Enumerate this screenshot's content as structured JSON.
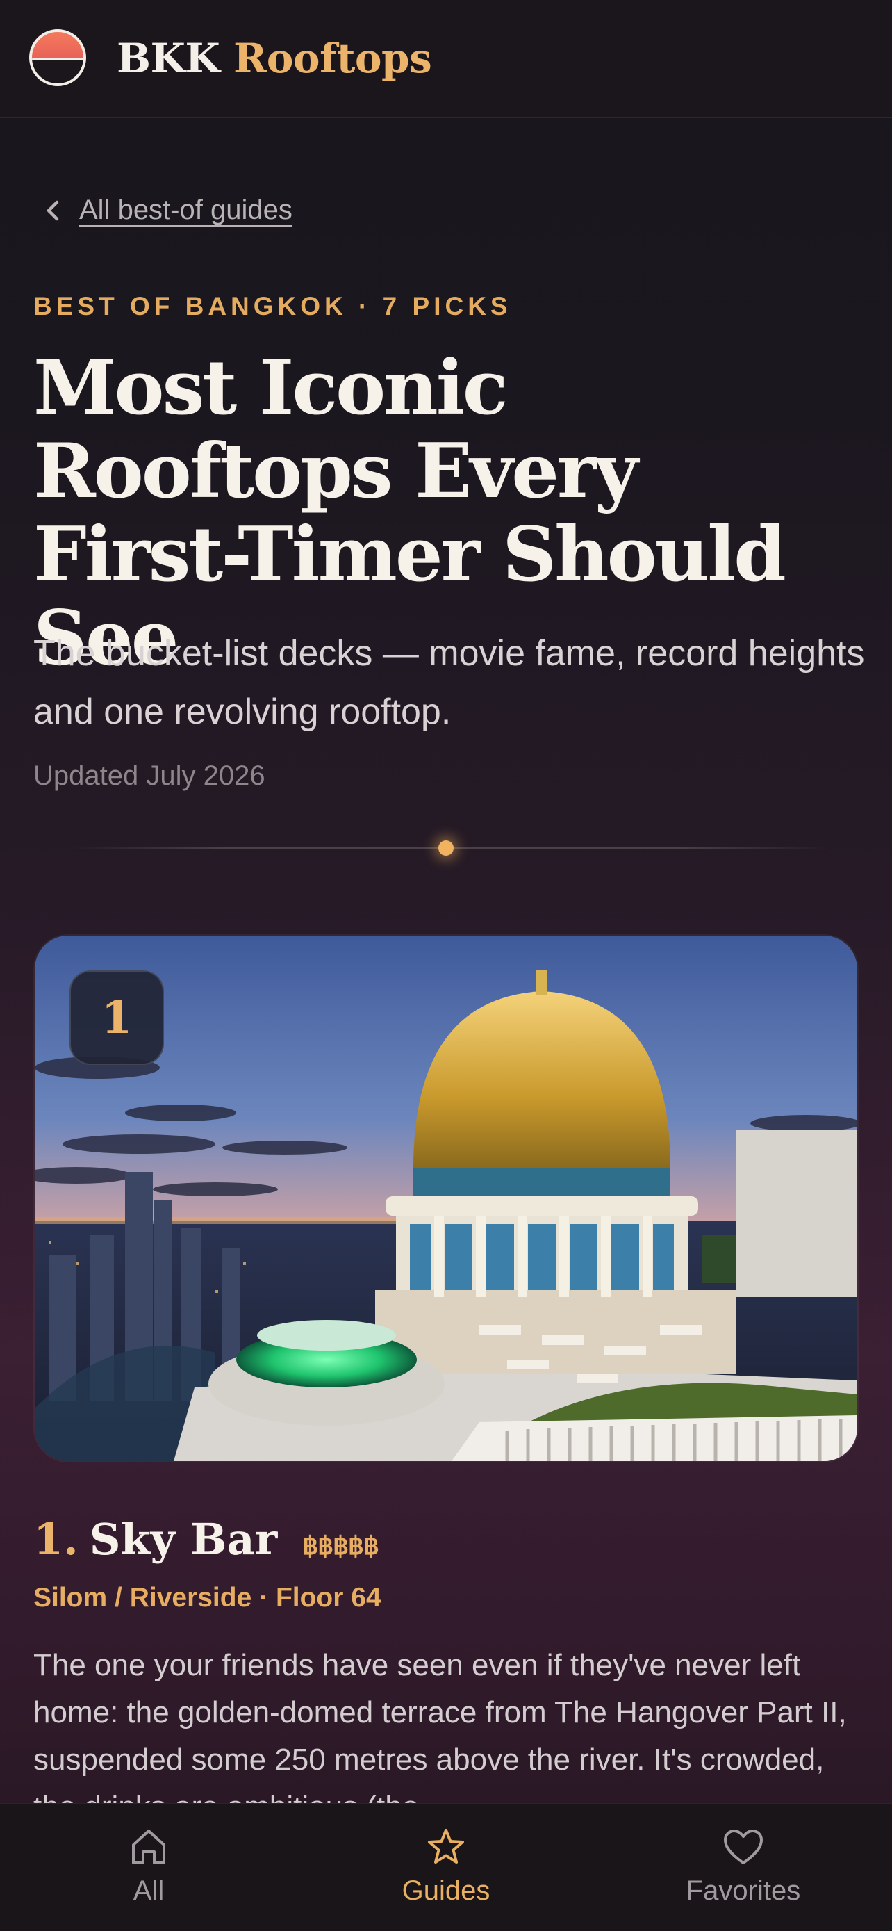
{
  "app": {
    "brand_part1": "BKK",
    "brand_part2": "Rooftops",
    "logo_icon": "sunset-logo-icon",
    "accent_color": "#ebb46a"
  },
  "header": {
    "back_label": "All best-of guides",
    "kicker": "BEST OF BANGKOK · 7 PICKS",
    "title": "Most Iconic Rooftops Every First-Timer Should See",
    "subtitle": "The bucket-list decks — movie fame, record heights and one revolving rooftop.",
    "updated": "Updated July 2026"
  },
  "pick": {
    "rank_badge": "1",
    "number": "1.",
    "name": "Sky Bar",
    "price": "฿฿฿฿฿",
    "meta": "Silom / Riverside · Floor 64",
    "description": "The one your friends have seen even if they've never left home: the golden-domed terrace from The Hangover Part II, suspended some 250 metres above the river. It's crowded, the drinks are ambitious (the"
  },
  "nav": {
    "items": [
      {
        "label": "All",
        "icon": "home-icon",
        "active": false
      },
      {
        "label": "Guides",
        "icon": "star-icon",
        "active": true
      },
      {
        "label": "Favorites",
        "icon": "heart-icon",
        "active": false
      }
    ]
  }
}
